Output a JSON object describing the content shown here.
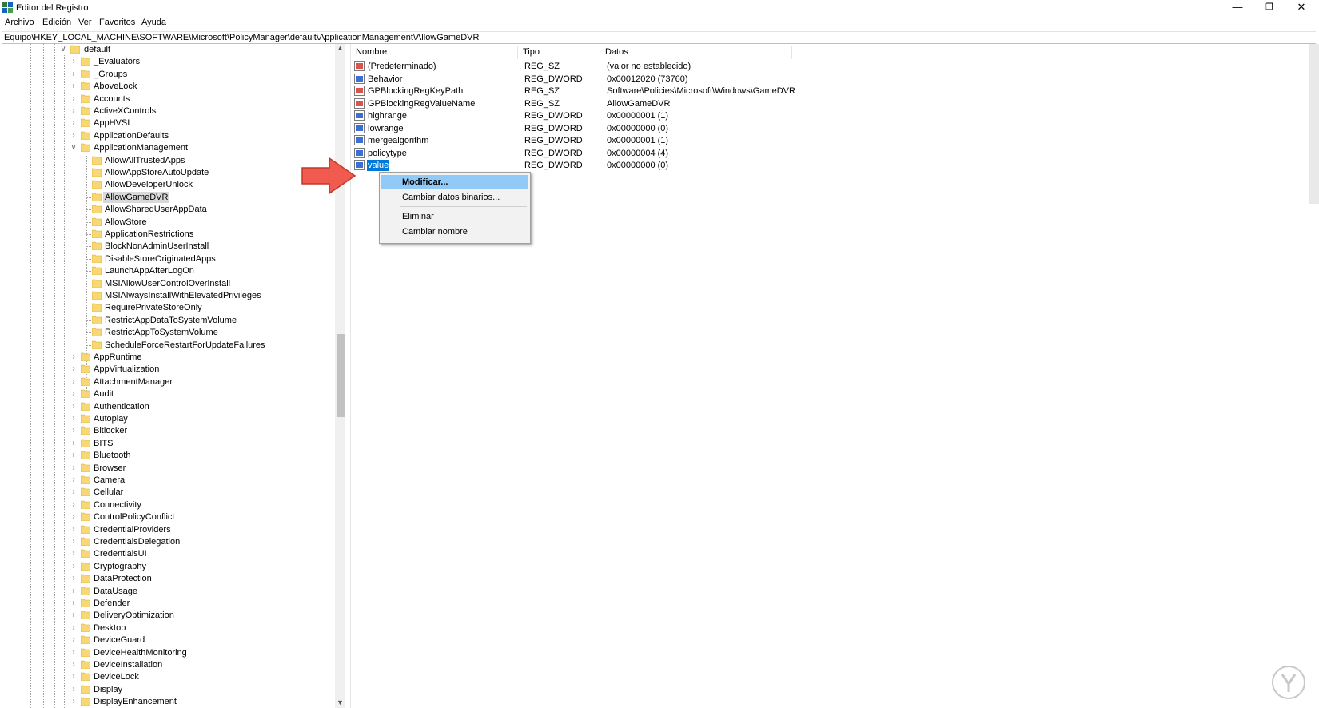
{
  "window": {
    "title": "Editor del Registro",
    "controls": {
      "minimize": "—",
      "restore": "❐",
      "close": "✕"
    }
  },
  "menu": [
    "Archivo",
    "Edición",
    "Ver",
    "Favoritos",
    "Ayuda"
  ],
  "address": "Equipo\\HKEY_LOCAL_MACHINE\\SOFTWARE\\Microsoft\\PolicyManager\\default\\ApplicationManagement\\AllowGameDVR",
  "tree": {
    "root": "default",
    "items": [
      {
        "label": "_Evaluators",
        "level": 1,
        "expanded": false
      },
      {
        "label": "_Groups",
        "level": 1,
        "expanded": false
      },
      {
        "label": "AboveLock",
        "level": 1,
        "expanded": false
      },
      {
        "label": "Accounts",
        "level": 1,
        "expanded": false
      },
      {
        "label": "ActiveXControls",
        "level": 1,
        "expanded": false
      },
      {
        "label": "AppHVSI",
        "level": 1,
        "expanded": false
      },
      {
        "label": "ApplicationDefaults",
        "level": 1,
        "expanded": false
      },
      {
        "label": "ApplicationManagement",
        "level": 1,
        "expanded": true
      },
      {
        "label": "AllowAllTrustedApps",
        "level": 2
      },
      {
        "label": "AllowAppStoreAutoUpdate",
        "level": 2
      },
      {
        "label": "AllowDeveloperUnlock",
        "level": 2
      },
      {
        "label": "AllowGameDVR",
        "level": 2,
        "selected": true
      },
      {
        "label": "AllowSharedUserAppData",
        "level": 2
      },
      {
        "label": "AllowStore",
        "level": 2
      },
      {
        "label": "ApplicationRestrictions",
        "level": 2
      },
      {
        "label": "BlockNonAdminUserInstall",
        "level": 2
      },
      {
        "label": "DisableStoreOriginatedApps",
        "level": 2
      },
      {
        "label": "LaunchAppAfterLogOn",
        "level": 2
      },
      {
        "label": "MSIAllowUserControlOverInstall",
        "level": 2
      },
      {
        "label": "MSIAlwaysInstallWithElevatedPrivileges",
        "level": 2
      },
      {
        "label": "RequirePrivateStoreOnly",
        "level": 2
      },
      {
        "label": "RestrictAppDataToSystemVolume",
        "level": 2
      },
      {
        "label": "RestrictAppToSystemVolume",
        "level": 2
      },
      {
        "label": "ScheduleForceRestartForUpdateFailures",
        "level": 2
      },
      {
        "label": "AppRuntime",
        "level": 1,
        "expanded": false
      },
      {
        "label": "AppVirtualization",
        "level": 1,
        "expanded": false
      },
      {
        "label": "AttachmentManager",
        "level": 1,
        "expanded": false
      },
      {
        "label": "Audit",
        "level": 1,
        "expanded": false
      },
      {
        "label": "Authentication",
        "level": 1,
        "expanded": false
      },
      {
        "label": "Autoplay",
        "level": 1,
        "expanded": false
      },
      {
        "label": "Bitlocker",
        "level": 1,
        "expanded": false
      },
      {
        "label": "BITS",
        "level": 1,
        "expanded": false
      },
      {
        "label": "Bluetooth",
        "level": 1,
        "expanded": false
      },
      {
        "label": "Browser",
        "level": 1,
        "expanded": false
      },
      {
        "label": "Camera",
        "level": 1,
        "expanded": false
      },
      {
        "label": "Cellular",
        "level": 1,
        "expanded": false
      },
      {
        "label": "Connectivity",
        "level": 1,
        "expanded": false
      },
      {
        "label": "ControlPolicyConflict",
        "level": 1,
        "expanded": false
      },
      {
        "label": "CredentialProviders",
        "level": 1,
        "expanded": false
      },
      {
        "label": "CredentialsDelegation",
        "level": 1,
        "expanded": false
      },
      {
        "label": "CredentialsUI",
        "level": 1,
        "expanded": false
      },
      {
        "label": "Cryptography",
        "level": 1,
        "expanded": false
      },
      {
        "label": "DataProtection",
        "level": 1,
        "expanded": false
      },
      {
        "label": "DataUsage",
        "level": 1,
        "expanded": false
      },
      {
        "label": "Defender",
        "level": 1,
        "expanded": false
      },
      {
        "label": "DeliveryOptimization",
        "level": 1,
        "expanded": false
      },
      {
        "label": "Desktop",
        "level": 1,
        "expanded": false
      },
      {
        "label": "DeviceGuard",
        "level": 1,
        "expanded": false
      },
      {
        "label": "DeviceHealthMonitoring",
        "level": 1,
        "expanded": false
      },
      {
        "label": "DeviceInstallation",
        "level": 1,
        "expanded": false
      },
      {
        "label": "DeviceLock",
        "level": 1,
        "expanded": false
      },
      {
        "label": "Display",
        "level": 1,
        "expanded": false
      },
      {
        "label": "DisplayEnhancement",
        "level": 1,
        "expanded": false
      }
    ]
  },
  "columns": {
    "name": "Nombre",
    "type": "Tipo",
    "data": "Datos"
  },
  "values": [
    {
      "name": "(Predeterminado)",
      "type": "REG_SZ",
      "data": "(valor no establecido)",
      "icon": "string-value-icon"
    },
    {
      "name": "Behavior",
      "type": "REG_DWORD",
      "data": "0x00012020 (73760)",
      "icon": "dword-value-icon"
    },
    {
      "name": "GPBlockingRegKeyPath",
      "type": "REG_SZ",
      "data": "Software\\Policies\\Microsoft\\Windows\\GameDVR",
      "icon": "string-value-icon"
    },
    {
      "name": "GPBlockingRegValueName",
      "type": "REG_SZ",
      "data": "AllowGameDVR",
      "icon": "string-value-icon"
    },
    {
      "name": "highrange",
      "type": "REG_DWORD",
      "data": "0x00000001 (1)",
      "icon": "dword-value-icon"
    },
    {
      "name": "lowrange",
      "type": "REG_DWORD",
      "data": "0x00000000 (0)",
      "icon": "dword-value-icon"
    },
    {
      "name": "mergealgorithm",
      "type": "REG_DWORD",
      "data": "0x00000001 (1)",
      "icon": "dword-value-icon"
    },
    {
      "name": "policytype",
      "type": "REG_DWORD",
      "data": "0x00000004 (4)",
      "icon": "dword-value-icon"
    },
    {
      "name": "value",
      "type": "REG_DWORD",
      "data": "0x00000000 (0)",
      "icon": "dword-value-icon",
      "selected": true
    }
  ],
  "context_menu": {
    "modify": "Modificar...",
    "modify_binary": "Cambiar datos binarios...",
    "delete": "Eliminar",
    "rename": "Cambiar nombre"
  },
  "colors": {
    "selection": "#0078d7",
    "menu_highlight": "#91c9f7",
    "arrow": "#f05a4f",
    "folder": "#f8d775"
  }
}
